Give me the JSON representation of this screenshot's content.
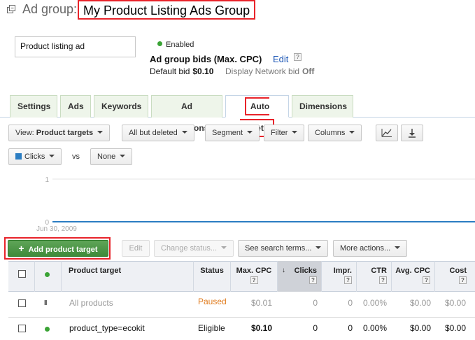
{
  "header": {
    "prefix": "Ad group:",
    "title": "My Product Listing Ads Group",
    "icon": "collapse-icon"
  },
  "ad_box": {
    "text": "Product listing ad"
  },
  "status": {
    "text": "Enabled",
    "color": "#3aa335"
  },
  "bids": {
    "title": "Ad group bids (Max. CPC)",
    "edit_label": "Edit",
    "help": "?",
    "default_label": "Default bid",
    "default_value": "$0.10",
    "network_label": "Display Network bid",
    "network_value": "Off"
  },
  "tabs": [
    "Settings",
    "Ads",
    "Keywords",
    "Ad extensions",
    "Auto targets",
    "Dimensions"
  ],
  "active_tab": "Auto targets",
  "toolbar": {
    "view_prefix": "View:",
    "view_value": "Product targets",
    "filter_deleted": "All but deleted",
    "segment": "Segment",
    "filter": "Filter",
    "columns": "Columns",
    "chart_icon": "line-chart-icon",
    "download_icon": "download-icon"
  },
  "metrics": {
    "primary": "Clicks",
    "primary_color": "#2b7dc2",
    "vs": "vs",
    "secondary": "None"
  },
  "chart_data": {
    "type": "line",
    "x": [
      "Jun 30, 2009"
    ],
    "series": [
      {
        "values": [
          0
        ]
      }
    ],
    "yticks": [
      "1",
      "0"
    ],
    "ylim": [
      0,
      1
    ]
  },
  "actions": {
    "add": "Add product target",
    "edit": "Edit",
    "change_status": "Change status...",
    "see_search": "See search terms...",
    "more_actions": "More actions..."
  },
  "table": {
    "columns": [
      "Product target",
      "Status",
      "Max. CPC",
      "Clicks",
      "Impr.",
      "CTR",
      "Avg. CPC",
      "Cost"
    ],
    "help": "?",
    "sorted_column": "Clicks",
    "rows": [
      {
        "target": "All products",
        "status": "Paused",
        "max_cpc": "$0.01",
        "clicks": "0",
        "impr": "0",
        "ctr": "0.00%",
        "avg_cpc": "$0.00",
        "cost": "$0.00"
      },
      {
        "target": "product_type=ecokit",
        "status": "Eligible",
        "max_cpc": "$0.10",
        "clicks": "0",
        "impr": "0",
        "ctr": "0.00%",
        "avg_cpc": "$0.00",
        "cost": "$0.00"
      }
    ]
  },
  "colors": {
    "accent_green": "#3f8a3a",
    "highlight_red": "#e8232a",
    "link_blue": "#1a55b5",
    "paused_orange": "#e07a1b"
  }
}
